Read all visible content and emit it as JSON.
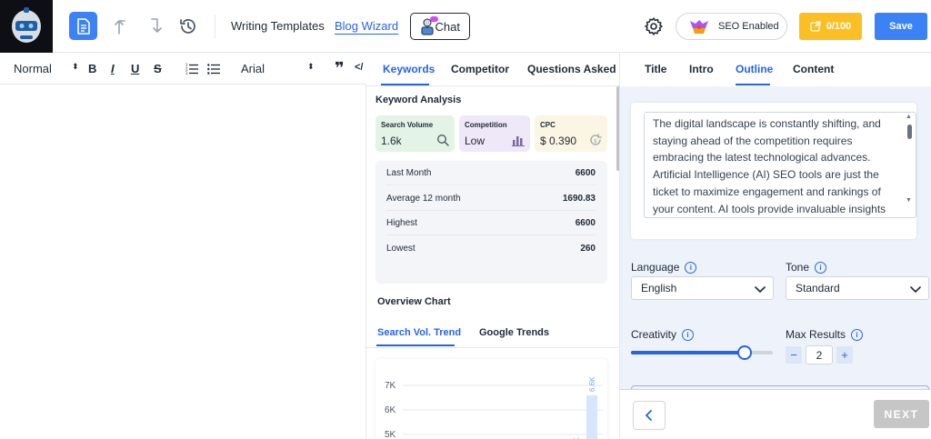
{
  "header": {
    "nav": [
      "Writing Templates",
      "Blog Wizard"
    ],
    "chat_label": "Chat",
    "seo_label": "SEO Enabled",
    "credits": "0/100",
    "save_label": "Save"
  },
  "editor_toolbar": {
    "style_value": "Normal",
    "font_value": "Arial"
  },
  "middle": {
    "tabs": [
      "Keywords",
      "Competitor",
      "Questions Asked"
    ],
    "analysis_title": "Keyword Analysis",
    "metrics": [
      {
        "label": "Search Volume",
        "value": "1.6k",
        "icon": "search-icon",
        "color": "#e3f4e6"
      },
      {
        "label": "Competition",
        "value": "Low",
        "icon": "bar-chart-icon",
        "color": "#eee8f8"
      },
      {
        "label": "CPC",
        "value": "$ 0.390",
        "icon": "refresh-dollar-icon",
        "color": "#fbf6e3"
      }
    ],
    "stats": [
      {
        "label": "Last Month",
        "value": "6600"
      },
      {
        "label": "Average 12 month",
        "value": "1690.83"
      },
      {
        "label": "Highest",
        "value": "6600"
      },
      {
        "label": "Lowest",
        "value": "260"
      }
    ],
    "overview_title": "Overview Chart",
    "chart_tabs": [
      "Search Vol. Trend",
      "Google Trends"
    ]
  },
  "chart_data": {
    "type": "bar",
    "categories": [],
    "series": [],
    "y_ticks": [
      "7K",
      "6K",
      "5K"
    ],
    "bar_labels": [
      "6.6K",
      "4K"
    ]
  },
  "right": {
    "tabs": [
      "Title",
      "Intro",
      "Outline",
      "Content"
    ],
    "intro_text": "The digital landscape is constantly shifting, and staying ahead of the competition requires embracing the latest technological advances. Artificial Intelligence (AI) SEO tools are just the ticket to maximize engagement and rankings of your content. AI tools provide invaluable insights",
    "language_label": "Language",
    "language_value": "English",
    "tone_label": "Tone",
    "tone_value": "Standard",
    "creativity_label": "Creativity",
    "creativity_level": 0.8,
    "max_results_label": "Max Results",
    "max_results_value": "2",
    "minus": "−",
    "plus": "+",
    "next_label": "NEXT"
  },
  "colors": {
    "accent": "#2563eb",
    "save": "#3b82f6",
    "credits": "#fbbf24",
    "next_disabled": "#c6c6c6"
  }
}
